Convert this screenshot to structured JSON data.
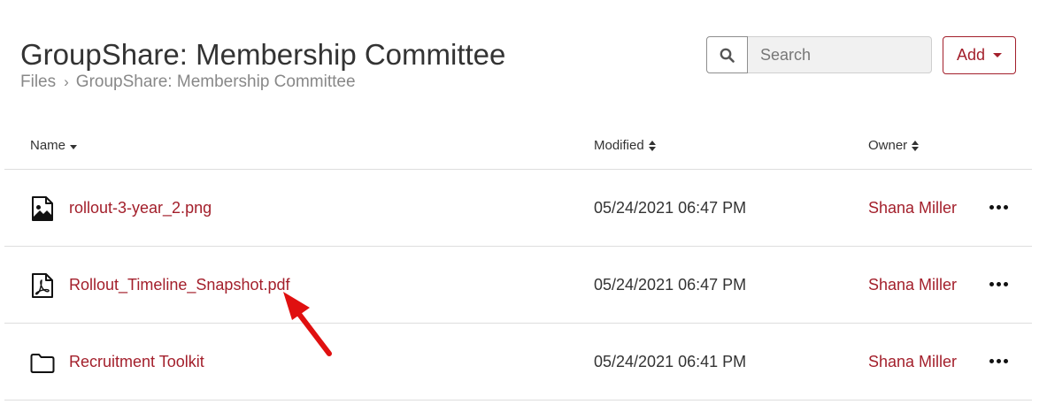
{
  "header": {
    "title": "GroupShare: Membership Committee",
    "breadcrumb": {
      "root": "Files",
      "separator": "›",
      "current": "GroupShare: Membership Committee"
    }
  },
  "toolbar": {
    "search_icon": "search-icon",
    "search_placeholder": "Search",
    "search_value": "",
    "add_label": "Add",
    "add_icon": "caret-down-icon"
  },
  "colors": {
    "accent": "#a31f2b",
    "text": "#333333",
    "muted": "#888888",
    "border": "#dedede",
    "annotation": "#e01010"
  },
  "table": {
    "columns": [
      {
        "label": "Name",
        "sort": "descending"
      },
      {
        "label": "Modified",
        "sort": "sortable"
      },
      {
        "label": "Owner",
        "sort": "sortable"
      }
    ],
    "rows": [
      {
        "icon": "image-file-icon",
        "name": "rollout-3-year_2.png",
        "modified": "05/24/2021 06:47 PM",
        "owner": "Shana Miller",
        "actions_icon": "more-options-icon"
      },
      {
        "icon": "pdf-file-icon",
        "name": "Rollout_Timeline_Snapshot.pdf",
        "modified": "05/24/2021 06:47 PM",
        "owner": "Shana Miller",
        "actions_icon": "more-options-icon"
      },
      {
        "icon": "folder-icon",
        "name": "Recruitment Toolkit",
        "modified": "05/24/2021 06:41 PM",
        "owner": "Shana Miller",
        "actions_icon": "more-options-icon"
      }
    ]
  },
  "annotation": {
    "icon": "red-arrow-pointer-icon",
    "points_to": "Rollout_Timeline_Snapshot.pdf"
  }
}
